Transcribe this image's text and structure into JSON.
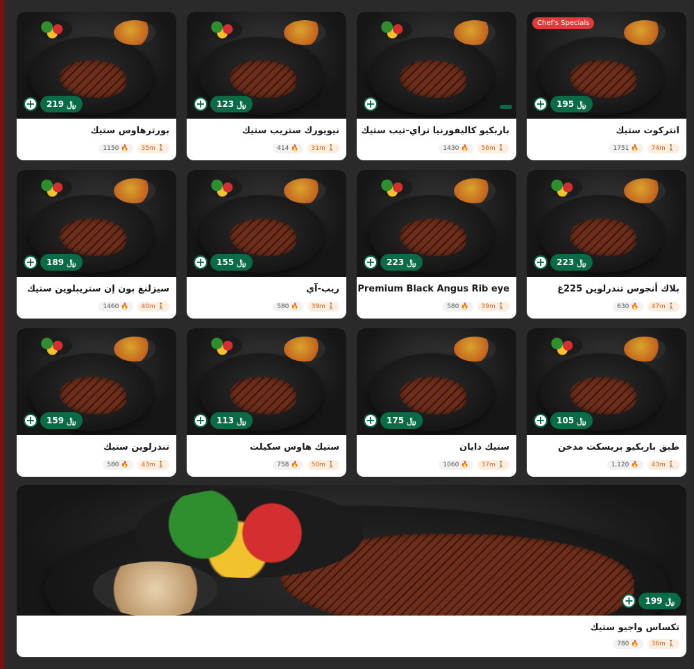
{
  "currency_symbol": "﷼",
  "colors": {
    "accent": "#0a6b47",
    "promo": "#e23a3a",
    "time_badge": "#fdeee0"
  },
  "items": [
    {
      "name": "انتركوت ستيك",
      "price": "195",
      "time": "74m",
      "cal": "1751",
      "promo": "Chef's Specials"
    },
    {
      "name": "باربكيو كاليفورنيا تراي-تيب ستيك",
      "price": "",
      "time": "56m",
      "cal": "1430"
    },
    {
      "name": "نيويورك ستريب ستيك",
      "price": "123",
      "time": "31m",
      "cal": "414"
    },
    {
      "name": "بورترهاوس ستيك",
      "price": "219",
      "time": "35m",
      "cal": "1150"
    },
    {
      "name": "بلاك أنجوس تندرلوين 225غ",
      "price": "223",
      "time": "47m",
      "cal": "630"
    },
    {
      "name": "Premium Black Angus Rib eye",
      "price": "223",
      "time": "39m",
      "cal": "580"
    },
    {
      "name": "ريب-آي",
      "price": "155",
      "time": "39m",
      "cal": "580"
    },
    {
      "name": "سيزلنغ بون إن ستريبلوين ستيك",
      "price": "189",
      "time": "40m",
      "cal": "1460"
    },
    {
      "name": "طبق باربكيو بريسكت مدخن",
      "price": "105",
      "time": "43m",
      "cal": "1,120"
    },
    {
      "name": "ستيك دايان",
      "price": "175",
      "time": "37m",
      "cal": "1060"
    },
    {
      "name": "ستيك هاوس سكيلت",
      "price": "113",
      "time": "50m",
      "cal": "758"
    },
    {
      "name": "تندرلوين ستيك",
      "price": "159",
      "time": "43m",
      "cal": "580"
    }
  ],
  "featured": {
    "name": "تكساس واجيو ستيك",
    "price": "199",
    "time": "36m",
    "cal": "780"
  }
}
